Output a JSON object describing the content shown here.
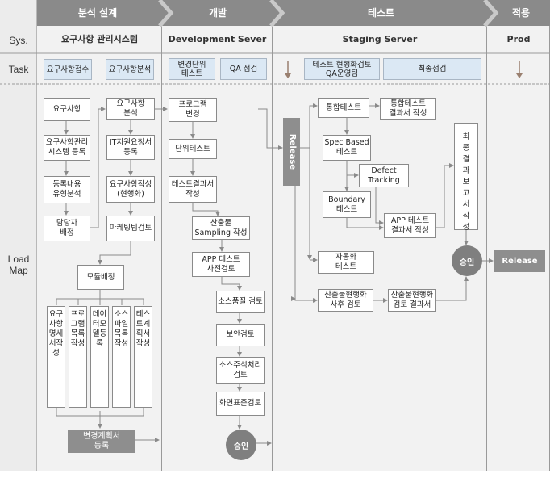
{
  "phases": [
    "분석 설계",
    "개발",
    "테스트",
    "적용"
  ],
  "rows": {
    "sys": "Sys.",
    "task": "Task",
    "roadmap": "Load\nMap"
  },
  "systems": [
    "요구사항 관리시스템",
    "Development Sever",
    "Staging Server",
    "Prod"
  ],
  "tasks": {
    "analysis": [
      "요구사항접수",
      "요구사항분석"
    ],
    "dev": [
      "변경단위\n테스트",
      "QA 점검"
    ],
    "test": [
      "테스트 현행화검토\nQA운영팀",
      "최종점검"
    ]
  },
  "analysis_boxes": {
    "req": "요구사항",
    "reg": "요구사항관리\n시스템 등록",
    "type": "등록내용\n유형분석",
    "owner": "담당자\n배정",
    "analyze": "요구사항\n분석",
    "it_reg": "IT지원요청서\n등록",
    "write": "요구사항작성\n(현행화)",
    "mkt": "마케팅팀검토",
    "module": "모듈배정"
  },
  "docs": [
    "요구사항명세서작성",
    "프로그램목록작성",
    "데이터모델등록",
    "소스파일목록작성",
    "테스트계획서작성"
  ],
  "change_plan": "변경계획서\n등록",
  "dev_boxes": {
    "prog": "프로그램\n변경",
    "unit": "단위테스트",
    "unit_result": "테스트결과서\n작성",
    "sampling": "산출물\nSampling 작성",
    "app_pre": "APP 테스트\n사전검토",
    "quality": "소스품질 검토",
    "security": "보안검토",
    "comment": "소스주석처리\n검토",
    "ui": "화면표준검토"
  },
  "approve": "승인",
  "release_label": "Release",
  "test_boxes": {
    "integ": "통합테스트",
    "integ_result": "통합테스트\n결과서 작성",
    "spec": "Spec Based\n테스트",
    "defect": "Defect\nTracking",
    "boundary": "Boundary\n테스트",
    "app_result": "APP 테스트\n결과서 작성",
    "auto": "자동화\n테스트",
    "post": "산출물현행화\n사후 검토",
    "post_result": "산출물현행화\n검토 결과서",
    "final": "최종결과 보고서작성"
  },
  "prod_release": "Release"
}
